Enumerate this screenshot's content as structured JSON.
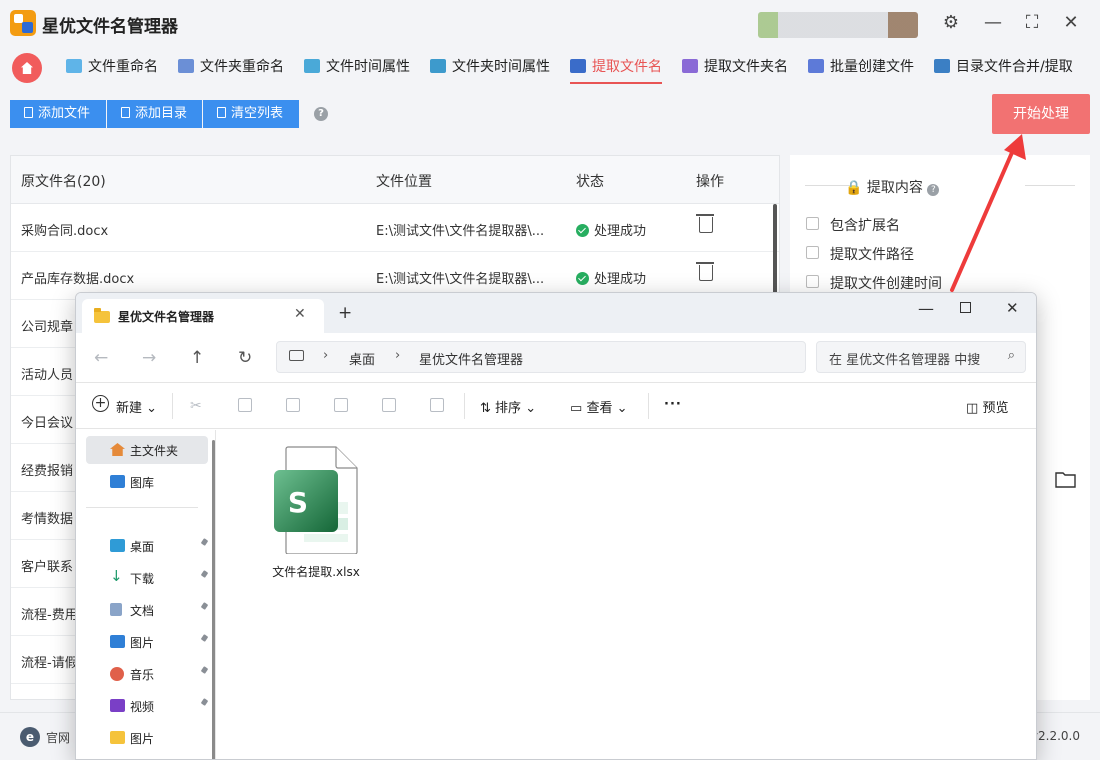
{
  "app": {
    "title": "星优文件名管理器",
    "accent": "#e85454",
    "window_controls": [
      "settings-icon",
      "minimize-icon",
      "maximize-icon",
      "close-icon"
    ]
  },
  "tabs": [
    {
      "label": "文件重命名",
      "icon": "rename-file-icon",
      "active": false
    },
    {
      "label": "文件夹重命名",
      "icon": "rename-folder-icon",
      "active": false
    },
    {
      "label": "文件时间属性",
      "icon": "file-time-icon",
      "active": false
    },
    {
      "label": "文件夹时间属性",
      "icon": "folder-time-icon",
      "active": false
    },
    {
      "label": "提取文件名",
      "icon": "extract-filename-icon",
      "active": true
    },
    {
      "label": "提取文件夹名",
      "icon": "extract-foldername-icon",
      "active": false
    },
    {
      "label": "批量创建文件",
      "icon": "batch-create-icon",
      "active": false
    },
    {
      "label": "目录文件合并/提取",
      "icon": "merge-dir-icon",
      "active": false
    }
  ],
  "toolbar": {
    "add_file": "添加文件",
    "add_dir": "添加目录",
    "clear_list": "清空列表",
    "help": "?",
    "start": "开始处理"
  },
  "table": {
    "headers": [
      "原文件名(20)",
      "文件位置",
      "状态",
      "操作"
    ],
    "rows": [
      {
        "name": "采购合同.docx",
        "path": "E:\\测试文件\\文件名提取器\\...",
        "status": "处理成功"
      },
      {
        "name": "产品库存数据.docx",
        "path": "E:\\测试文件\\文件名提取器\\...",
        "status": "处理成功"
      },
      {
        "name": "公司规章",
        "path": "",
        "status": ""
      },
      {
        "name": "活动人员",
        "path": "",
        "status": ""
      },
      {
        "name": "今日会议",
        "path": "",
        "status": ""
      },
      {
        "name": "经费报销",
        "path": "",
        "status": ""
      },
      {
        "name": "考情数据",
        "path": "",
        "status": ""
      },
      {
        "name": "客户联系",
        "path": "",
        "status": ""
      },
      {
        "name": "流程-费用",
        "path": "",
        "status": ""
      },
      {
        "name": "流程-请假",
        "path": "",
        "status": ""
      }
    ]
  },
  "panel": {
    "title": "提取内容",
    "options": [
      "包含扩展名",
      "提取文件路径",
      "提取文件创建时间"
    ]
  },
  "footer": {
    "website": "官网",
    "version": "v2.2.0.0"
  },
  "explorer": {
    "tab_title": "星优文件名管理器",
    "new_tab": "+",
    "breadcrumb": [
      "桌面",
      "星优文件名管理器"
    ],
    "search_placeholder": "在 星优文件名管理器 中搜",
    "new_label": "新建",
    "sort_label": "排序",
    "view_label": "查看",
    "more": "···",
    "preview_label": "预览",
    "sidebar": [
      {
        "label": "主文件夹",
        "icon": "home-icon",
        "pinned": false,
        "selected": true
      },
      {
        "label": "图库",
        "icon": "gallery-icon",
        "pinned": false,
        "selected": false
      },
      {
        "label": "桌面",
        "icon": "desktop-icon",
        "pinned": true,
        "selected": false
      },
      {
        "label": "下载",
        "icon": "download-icon",
        "pinned": true,
        "selected": false
      },
      {
        "label": "文档",
        "icon": "documents-icon",
        "pinned": true,
        "selected": false
      },
      {
        "label": "图片",
        "icon": "pictures-icon",
        "pinned": true,
        "selected": false
      },
      {
        "label": "音乐",
        "icon": "music-icon",
        "pinned": true,
        "selected": false
      },
      {
        "label": "视频",
        "icon": "video-icon",
        "pinned": true,
        "selected": false
      },
      {
        "label": "图片",
        "icon": "folder-icon",
        "pinned": false,
        "selected": false
      }
    ],
    "files": [
      {
        "name": "文件名提取.xlsx",
        "icon": "excel-file-icon"
      }
    ]
  }
}
